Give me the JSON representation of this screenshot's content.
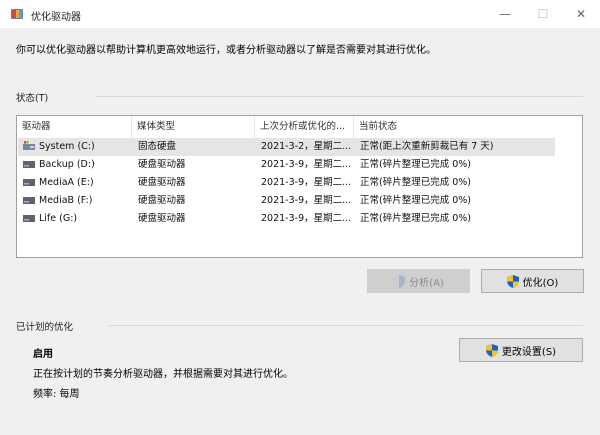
{
  "window": {
    "title": "优化驱动器"
  },
  "intro": "你可以优化驱动器以帮助计算机更高效地运行，或者分析驱动器以了解是否需要对其进行优化。",
  "status": {
    "group_label": "状态(T)",
    "columns": [
      "驱动器",
      "媒体类型",
      "上次分析或优化的...",
      "当前状态"
    ],
    "drives": [
      {
        "name": "System (C:)",
        "media": "固态硬盘",
        "last": "2021-3-2，星期二...",
        "state": "正常(距上次重新剪裁已有 7 天)",
        "icon": "ssd-system-icon"
      },
      {
        "name": "Backup (D:)",
        "media": "硬盘驱动器",
        "last": "2021-3-9，星期二...",
        "state": "正常(碎片整理已完成 0%)",
        "icon": "hdd-icon"
      },
      {
        "name": "MediaA (E:)",
        "media": "硬盘驱动器",
        "last": "2021-3-9，星期二...",
        "state": "正常(碎片整理已完成 0%)",
        "icon": "hdd-icon"
      },
      {
        "name": "MediaB (F:)",
        "media": "硬盘驱动器",
        "last": "2021-3-9，星期二...",
        "state": "正常(碎片整理已完成 0%)",
        "icon": "hdd-icon"
      },
      {
        "name": "Life (G:)",
        "media": "硬盘驱动器",
        "last": "2021-3-9，星期二...",
        "state": "正常(碎片整理已完成 0%)",
        "icon": "hdd-icon"
      }
    ]
  },
  "buttons": {
    "analyze": "分析(A)",
    "optimize": "优化(O)",
    "change_settings": "更改设置(S)"
  },
  "schedule": {
    "group_label": "已计划的优化",
    "state": "启用",
    "description": "正在按计划的节奏分析驱动器，并根据需要对其进行优化。",
    "frequency": "频率: 每周"
  },
  "colors": {
    "shield_blue": "#1f5fbf",
    "shield_yellow": "#f2c12e",
    "selection": "#e5e5e5"
  }
}
